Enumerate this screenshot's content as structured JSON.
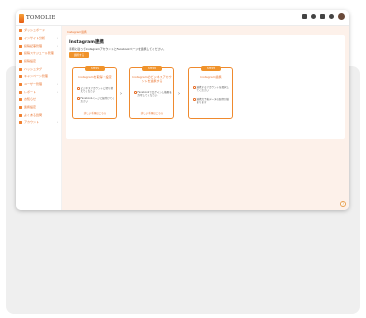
{
  "app": {
    "title": "TOMOLIE"
  },
  "sidebar": {
    "items": [
      {
        "label": "ダッシュボード",
        "chevron": ""
      },
      {
        "label": "インサイト分析",
        "chevron": "›"
      },
      {
        "label": "投稿記事管理",
        "chevron": "›"
      },
      {
        "label": "投稿スケジュール管理",
        "chevron": ""
      },
      {
        "label": "投稿設定",
        "chevron": ""
      },
      {
        "label": "ハッシュタグ",
        "chevron": ""
      },
      {
        "label": "キャンペーン管理",
        "chevron": ""
      },
      {
        "label": "ユーザー管理",
        "chevron": "›"
      },
      {
        "label": "レポート",
        "chevron": "›"
      },
      {
        "label": "お知らせ",
        "chevron": ""
      },
      {
        "label": "連携設定",
        "chevron": ""
      },
      {
        "label": "よくある質問",
        "chevron": ""
      },
      {
        "label": "アカウント",
        "chevron": "›"
      }
    ]
  },
  "main": {
    "breadcrumb": "Instagram連携",
    "title": "Instagram連携",
    "description": "手順に従ってInstagramアカウントとFacebookページを連携してください。",
    "primary_button": "連携する",
    "steps": [
      {
        "badge": "STEP1",
        "title": "Instagramを取得・設定",
        "lines": [
          "ビジネスアカウントに切り替えてください",
          "Facebookページと紐付けてください"
        ],
        "link": "詳しい手順はこちら"
      },
      {
        "badge": "STEP2",
        "title": "Instagramのビジネスアカウントを連携する",
        "lines": [
          "Facebookでログインし権限を許可してください"
        ],
        "link": "詳しい手順はこちら"
      },
      {
        "badge": "STEP3",
        "title": "Instagram連携",
        "lines": [
          "連携するアカウントを選択してください",
          "連携完了後データの取得が始まります"
        ],
        "link": ""
      }
    ]
  },
  "icons": {
    "help": "?",
    "arrow": "›"
  },
  "colors": {
    "accent": "#f0932b",
    "content_bg": "#fdf1ea"
  }
}
